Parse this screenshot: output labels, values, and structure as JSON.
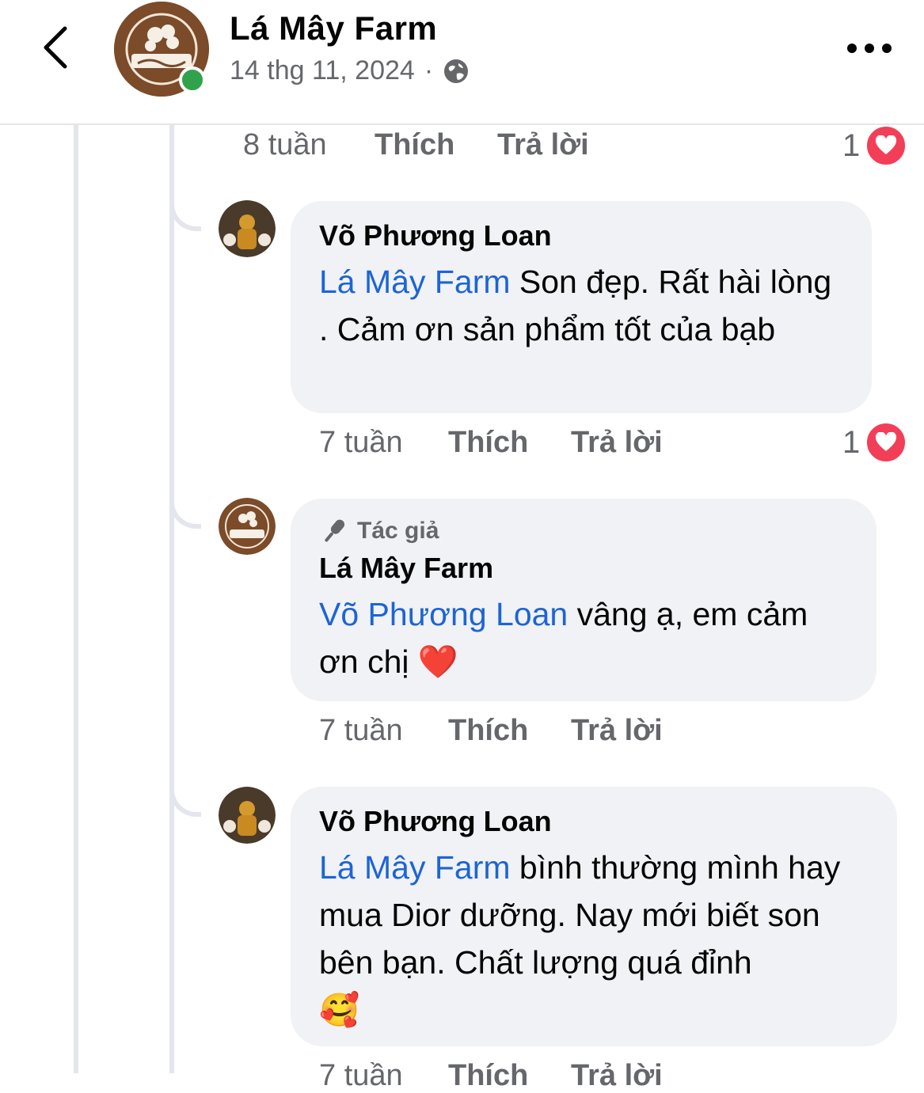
{
  "header": {
    "page_name": "Lá Mây Farm",
    "date": "14 thg 11, 2024",
    "separator": "·"
  },
  "top_actions": {
    "time": "8 tuần",
    "like": "Thích",
    "reply": "Trả lời",
    "reaction_count": "1"
  },
  "comments": [
    {
      "author": "Võ Phương Loan",
      "mention": "Lá Mây Farm",
      "text": " Son đẹp. Rất hài lòng  . Cảm ơn sản phẩm tốt của bạb",
      "time": "7 tuần",
      "like": "Thích",
      "reply": "Trả lời",
      "reaction_count": "1"
    },
    {
      "badge": "Tác giả",
      "author": "Lá Mây Farm",
      "mention": "Võ Phương Loan",
      "text": " vâng ạ, em cảm ơn chị ",
      "emoji": "❤️",
      "time": "7 tuần",
      "like": "Thích",
      "reply": "Trả lời"
    },
    {
      "author": "Võ Phương Loan",
      "mention": "Lá Mây Farm",
      "text": " bình thường mình hay mua Dior dưỡng. Nay mới biết son bên bạn. Chất lượng quá đỉnh",
      "emoji": "🥰",
      "time": "7 tuần",
      "like": "Thích",
      "reply": "Trả lời"
    }
  ],
  "colors": {
    "mention": "#1d64d6",
    "bubble": "#f0f2f5",
    "heart": "#f33e58",
    "online": "#31a24c"
  }
}
